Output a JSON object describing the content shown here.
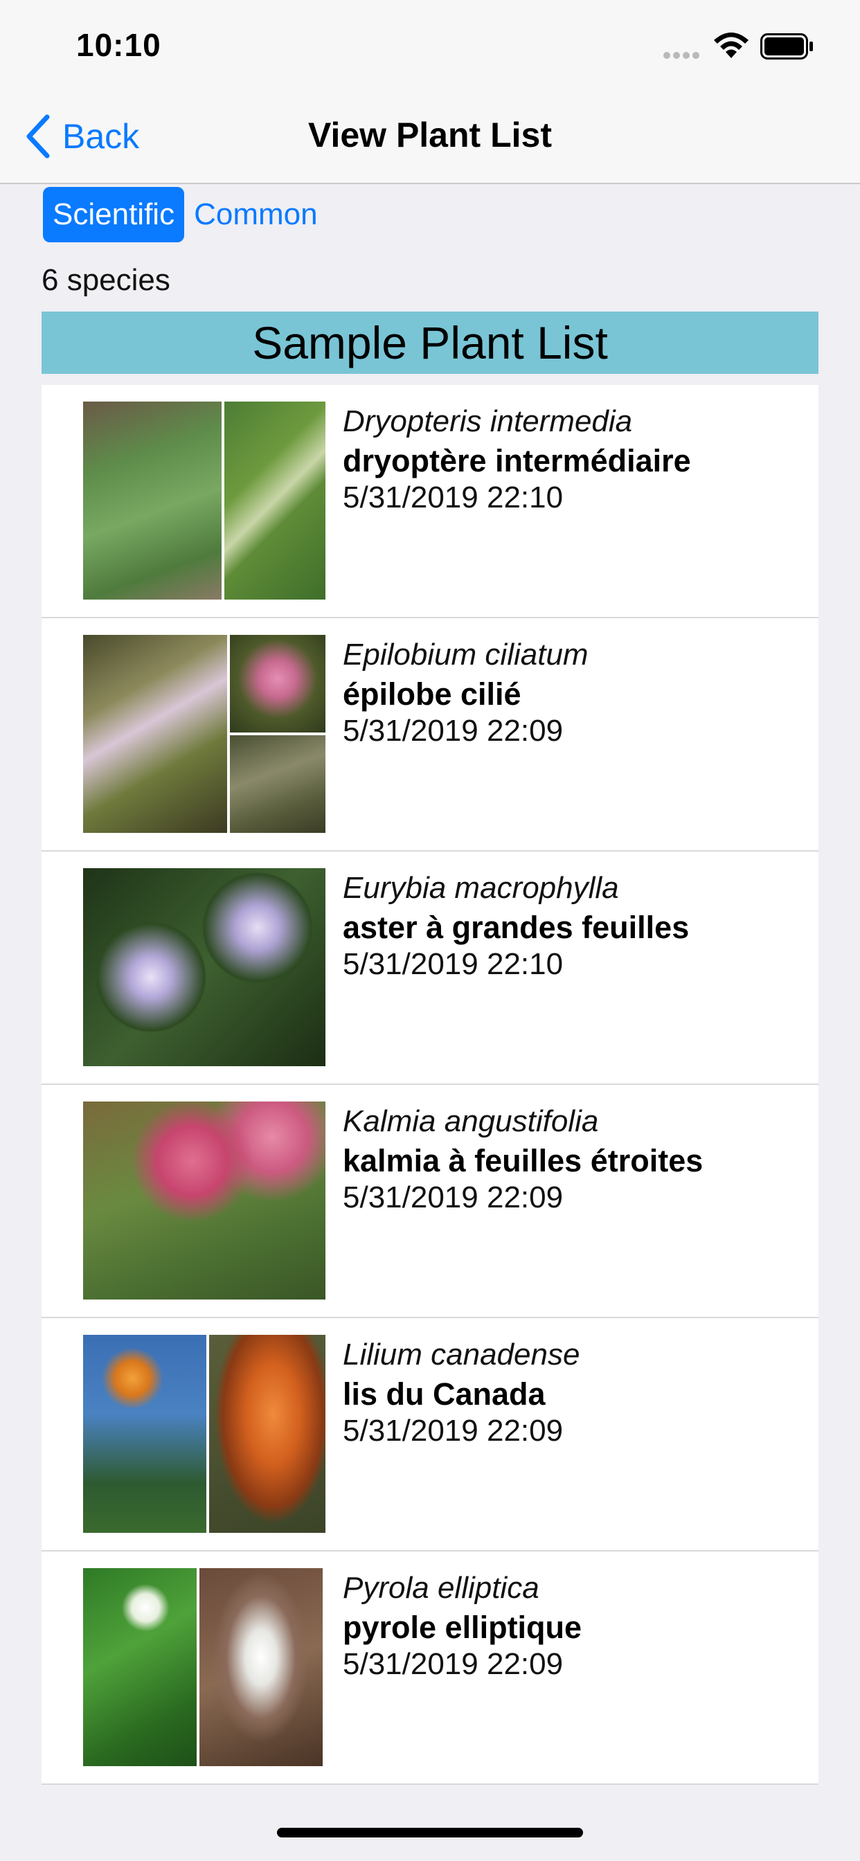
{
  "status": {
    "time": "10:10"
  },
  "nav": {
    "back_label": "Back",
    "title": "View Plant List"
  },
  "segmented": {
    "options": [
      "Scientific",
      "Common"
    ],
    "selected": "Scientific"
  },
  "species_count": "6 species",
  "list_title": "Sample Plant List",
  "plants": [
    {
      "scientific": "Dryopteris intermedia",
      "common": "dryoptère intermédiaire",
      "date": "5/31/2019 22:10"
    },
    {
      "scientific": "Epilobium ciliatum",
      "common": "épilobe cilié",
      "date": "5/31/2019 22:09"
    },
    {
      "scientific": "Eurybia macrophylla",
      "common": "aster à grandes feuilles",
      "date": "5/31/2019 22:10"
    },
    {
      "scientific": "Kalmia angustifolia",
      "common": "kalmia à feuilles étroites",
      "date": "5/31/2019 22:09"
    },
    {
      "scientific": "Lilium canadense",
      "common": "lis du Canada",
      "date": "5/31/2019 22:09"
    },
    {
      "scientific": "Pyrola elliptica",
      "common": "pyrole elliptique",
      "date": "5/31/2019 22:09"
    }
  ],
  "colors": {
    "accent": "#0a7aff",
    "header_bg": "#79c5d6"
  }
}
